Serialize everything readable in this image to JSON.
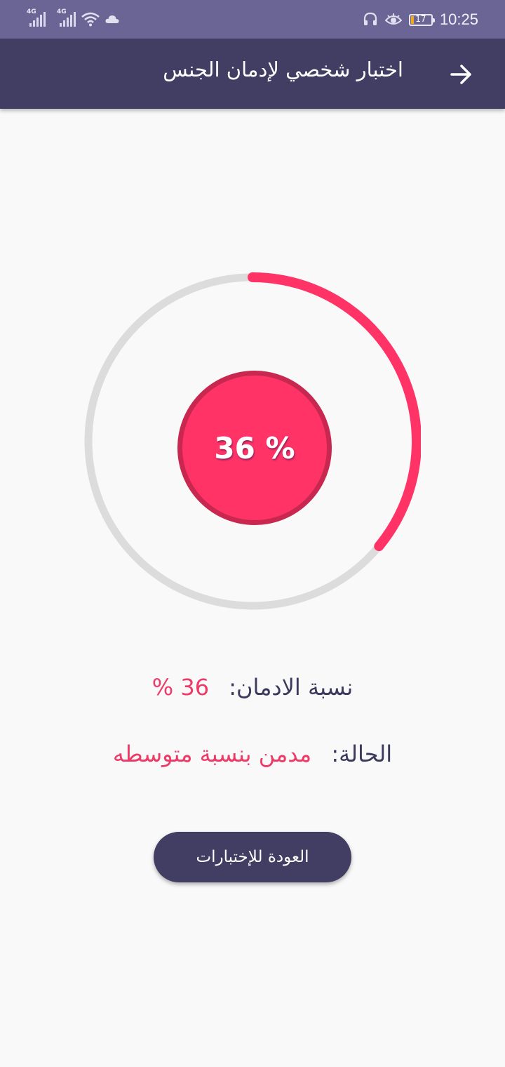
{
  "status_bar": {
    "network1": "4G",
    "network2": "4G",
    "battery_level": "17",
    "time": "10:25",
    "icons": [
      "signal-icon",
      "signal-icon",
      "wifi-icon",
      "cloud-icon",
      "headset-icon",
      "eye-icon",
      "battery-icon"
    ]
  },
  "app_bar": {
    "title": "اختبار شخصي لإدمان الجنس",
    "back_icon": "arrow-right-icon"
  },
  "result": {
    "percent": 36,
    "percent_text": "36 %",
    "colors": {
      "progress": "#ff3366",
      "track": "#dcdcdc",
      "center_border": "#c8284f"
    }
  },
  "details": {
    "addiction_label": "نسبة الادمان:",
    "addiction_value": "36 %",
    "status_label": "الحالة:",
    "status_value": "مدمن بنسبة متوسطه"
  },
  "actions": {
    "back_button_label": "العودة للإختبارات"
  },
  "colors": {
    "status_bar": "#6b6596",
    "app_bar": "#423e63",
    "accent": "#ee3a67",
    "background": "#f9f9f9"
  }
}
